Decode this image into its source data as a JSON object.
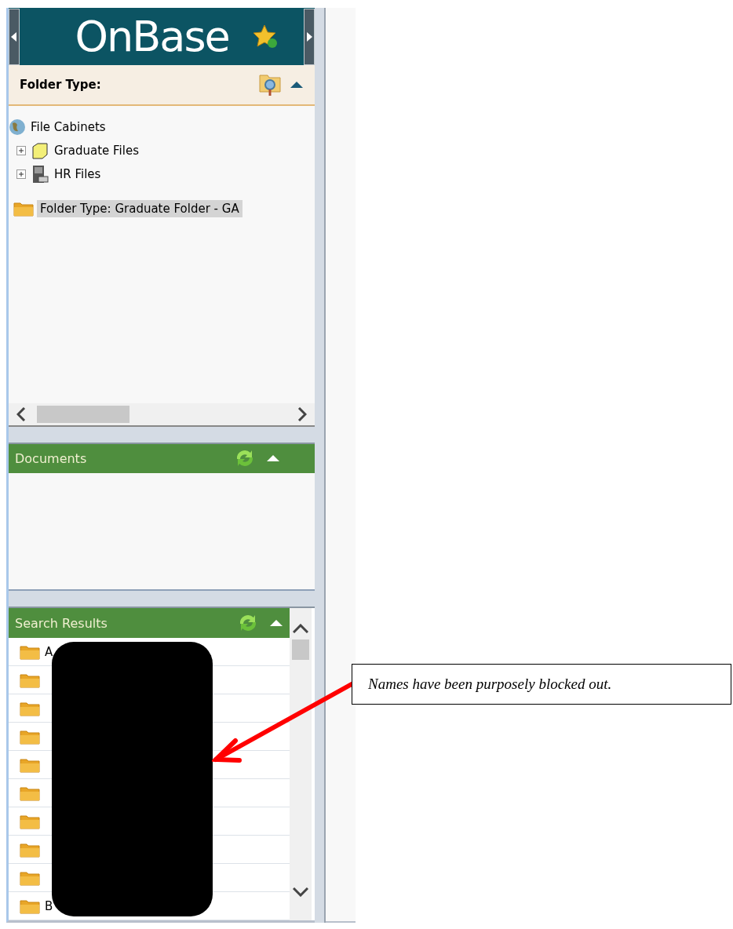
{
  "header": {
    "logo": "OnBase"
  },
  "folder_type": {
    "title": "Folder Type:"
  },
  "tree": [
    {
      "label": "File Cabinets",
      "kind": "globe",
      "children": [
        {
          "label": "Graduate Files",
          "kind": "folder",
          "expanded": false
        },
        {
          "label": "HR Files",
          "kind": "cabinet",
          "expanded": false
        }
      ]
    }
  ],
  "selected_folder": {
    "label": "Folder Type: Graduate Folder - GA",
    "selected": true
  },
  "documents": {
    "title": "Documents"
  },
  "search_results": {
    "title": "Search Results",
    "rows": [
      {
        "kind": "folder",
        "label": "A"
      },
      {
        "kind": "folder"
      },
      {
        "kind": "folder"
      },
      {
        "kind": "folder"
      },
      {
        "kind": "folder"
      },
      {
        "kind": "folder"
      },
      {
        "kind": "folder"
      },
      {
        "kind": "folder"
      },
      {
        "kind": "folder"
      },
      {
        "kind": "folder",
        "label": "B"
      }
    ]
  },
  "annotation": {
    "text": "Names have been purposely blocked out."
  }
}
